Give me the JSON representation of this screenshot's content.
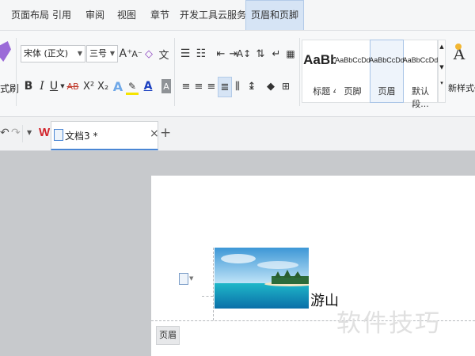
{
  "menu": {
    "items": [
      "页面布局",
      "引用",
      "审阅",
      "视图",
      "章节",
      "开发工具",
      "云服务",
      "页眉和页脚"
    ],
    "active_index": 7
  },
  "ribbon": {
    "format_painter_label": "式刷",
    "font_name": "宋体 (正文)",
    "font_size": "三号",
    "grow_font": "A⁺",
    "shrink_font": "A⁻",
    "phonetic": "文",
    "bold": "B",
    "italic": "I",
    "underline": "U",
    "strike": "AB",
    "superscript": "X²",
    "subscript": "X₂",
    "text_effect": "A",
    "font_color": "A",
    "char_shading": "A",
    "styles": [
      {
        "sample": "AaBbC",
        "name": "标题 4"
      },
      {
        "sample": "AaBbCcDd",
        "name": "页脚"
      },
      {
        "sample": "AaBbCcDd",
        "name": "页眉"
      },
      {
        "sample": "AaBbCcDd",
        "name": "默认段..."
      }
    ],
    "new_style_label": "新样式",
    "new_style_icon_text": "A",
    "accent_color": "#2f6fc9",
    "highlight_color": "#f5e400",
    "font_color_bar": "#1a3fc0"
  },
  "tabs": {
    "doc_title": "文档3 *",
    "close": "×",
    "new_tab": "+",
    "wps_logo": "W"
  },
  "document": {
    "header_text": "游山",
    "header_label": "页眉",
    "watermark": "软件技巧"
  }
}
